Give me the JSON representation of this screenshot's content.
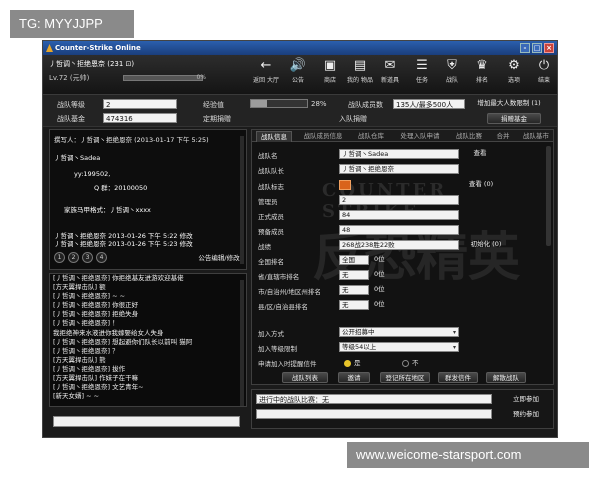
{
  "overlay": {
    "tag_top": "TG: MYYJJPP",
    "tag_bottom": "www.weicome-starsport.com"
  },
  "window": {
    "title": "Counter-Strike Online",
    "minimize": "-",
    "maximize": "□",
    "close": "×"
  },
  "player": {
    "name": "丿哲调丶拒绝恩奈 (231 ⊡)",
    "level": "Lv.72 (元帅)",
    "xp_percent": 0,
    "xp_label": "0%"
  },
  "nav": [
    {
      "label": "返回 大厅",
      "icon": "back-arrow-icon",
      "glyph": "←"
    },
    {
      "label": "公告",
      "icon": "speaker-icon",
      "glyph": "🔊"
    },
    {
      "label": "商店",
      "icon": "shop-icon",
      "glyph": "▣"
    },
    {
      "label": "我的 物品",
      "icon": "inventory-icon",
      "glyph": "▤"
    },
    {
      "label": "新道具",
      "icon": "new-item-icon",
      "glyph": "✉"
    },
    {
      "label": "任务",
      "icon": "quest-icon",
      "glyph": "☰"
    },
    {
      "label": "战队",
      "icon": "clan-shield-icon",
      "glyph": "⛨"
    },
    {
      "label": "排名",
      "icon": "trophy-icon",
      "glyph": "♛"
    },
    {
      "label": "选项",
      "icon": "gear-icon",
      "glyph": "⚙"
    },
    {
      "label": "结束",
      "icon": "power-icon",
      "glyph": "⏻"
    }
  ],
  "clan_stats": {
    "level_label": "战队等级",
    "level_value": "2",
    "exp_label": "经验值",
    "exp_percent": 28,
    "exp_text": "28%",
    "members_label": "战队成员数",
    "members_value": "135人/最多500人",
    "increase_label": "增加最大人数限制 (1)",
    "fund_label": "战队基金",
    "fund_value": "474316",
    "cycle_label": "定期捐赠",
    "entry_label": "入队捐赠",
    "donate_button": "捐赠基金"
  },
  "post": {
    "header": "撰写人：丿哲调丶拒绝恩奈 (2013-01-17 下午 5:25)",
    "lines": [
      "丿哲调丶Sadea",
      "yy:199502,",
      "Q 群：20100050",
      "家族马甲格式：丿哲调丶xxxx",
      "丿哲调丶拒绝恩奈 2013-01-26 下午 5:22 修改",
      "丿哲调丶拒绝恩奈 2013-01-26 下午 5:23 修改"
    ],
    "pages": [
      "1",
      "2",
      "3",
      "4"
    ],
    "edit_label": "公告编辑/修改"
  },
  "chat": [
    "[丿哲调丶拒绝恩奈] 你拒绝基友进游欢迎基佬",
    "[方天翼捍击队] 额",
    "[丿哲调丶拒绝恩奈] ~ ~",
    "[丿哲调丶拒绝恩奈] 你很正好",
    "[丿哲调丶拒绝恩奈] 拒绝失身",
    "[丿哲调丶拒绝恩奈] ！",
    "我拒绝神来水液进你我嫁娶给女人失身",
    "[丿哲调丶拒绝恩奈] 想起避你们队长以前叫 猫阿",
    "[丿哲调丶拒绝恩奈] ？",
    "[方天翼捍击队] 熊",
    "[丿哲调丶拒绝恩奈] 拔作",
    "[方天翼捍击队] 作妹子在干嘛",
    "[丿哲调丶拒绝恩奈] 文艺青年~",
    "[新天女婿] ~ ~"
  ],
  "tabs": [
    "战队信息",
    "战队成员信息",
    "战队仓库",
    "处理入队申请",
    "战队比赛",
    "合并",
    "战队基市"
  ],
  "watermark": {
    "line1": "COUNTER STRIKE",
    "line2": "反恐精英"
  },
  "info": {
    "name_label": "战队名",
    "name_value": "丿哲调丶Sadea",
    "name_button": "查看",
    "leader_label": "战队队长",
    "leader_value": "丿哲调丶拒绝恩奈",
    "mark_label": "战队标志",
    "mark_button": "查看 (0)",
    "admin_label": "管理员",
    "admin_value": "2",
    "regular_label": "正式成员",
    "regular_value": "84",
    "reserve_label": "预备成员",
    "reserve_value": "48",
    "record_label": "战绩",
    "record_value": "268战238胜22败",
    "reset_button": "初始化 (0)",
    "national_label": "全国排名",
    "national_value": "全国",
    "national_rank": "0位",
    "province_label": "省/直辖市排名",
    "province_value": "无",
    "province_rank": "0位",
    "city_label": "市/自治州/地区州排名",
    "city_value": "无",
    "city_rank": "0位",
    "county_label": "县/区/自治县排名",
    "county_value": "无",
    "county_rank": "0位",
    "join_label": "加入方式",
    "join_value": "公开招募中",
    "level_limit_label": "加入等级限制",
    "level_limit_value": "等级54以上",
    "alert_label": "申请加入时提醒信件",
    "alert_on": "是",
    "alert_off": "不"
  },
  "actions": [
    "战队列表",
    "邀请",
    "登记所在地区",
    "群发信件",
    "解散战队"
  ],
  "match": {
    "label": "进行中的战队比赛：",
    "value": "无",
    "join_button": "立即参加",
    "reserve_button": "预约参加"
  }
}
